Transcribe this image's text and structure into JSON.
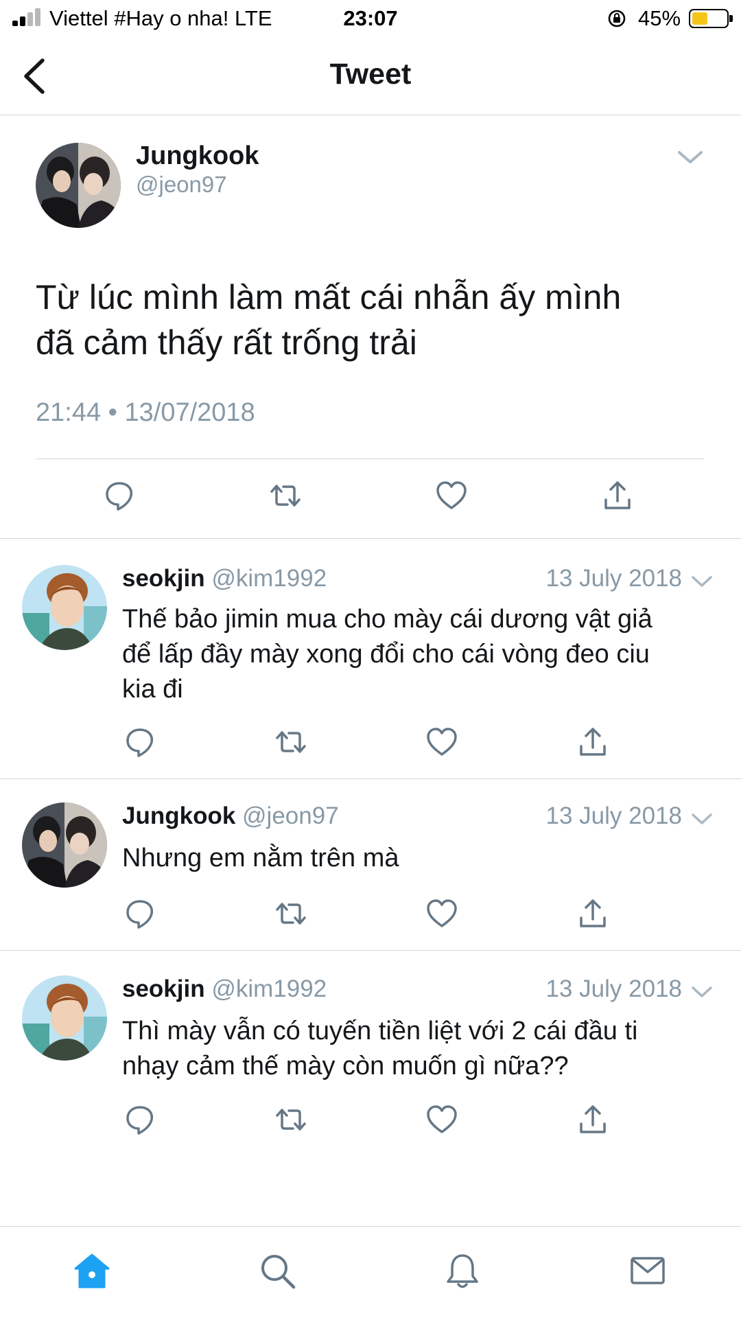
{
  "status_bar": {
    "carrier": "Viettel #Hay o nha!  LTE",
    "time": "23:07",
    "battery": "45%",
    "battery_level": 0.45
  },
  "nav": {
    "title": "Tweet"
  },
  "main_tweet": {
    "name": "Jungkook",
    "handle": "@jeon97",
    "text_line1": "Từ lúc mình làm mất cái nhẫn ấy mình",
    "text_line2": "đã cảm thấy rất trống trải",
    "timestamp": "21:44 • 13/07/2018"
  },
  "replies": [
    {
      "name": "seokjin",
      "handle": "@kim1992",
      "date": "13 July 2018",
      "text_line1": "Thế bảo jimin mua cho mày cái dương vật giả",
      "text_line2": "để lấp đầy mày xong đổi cho cái vòng đeo ciu",
      "text_line3": "kia đi"
    },
    {
      "name": "Jungkook",
      "handle": "@jeon97",
      "date": "13 July 2018",
      "text_line1": "Nhưng em nằm trên mà"
    },
    {
      "name": "seokjin",
      "handle": "@kim1992",
      "date": "13 July 2018",
      "text_line1": "Thì mày vẫn có tuyến tiền liệt với 2 cái đầu ti",
      "text_line2": "nhạy cảm thế mày còn muốn gì nữa??"
    }
  ],
  "icons": {
    "reply": "reply-icon",
    "retweet": "retweet-icon",
    "like": "heart-icon",
    "share": "share-icon",
    "home": "home-icon",
    "search": "search-icon",
    "notifications": "bell-icon",
    "messages": "mail-icon"
  },
  "colors": {
    "accent": "#1da1f2",
    "secondary_text": "#8899a6",
    "icon_gray": "#657786",
    "divider": "#d0d5da"
  }
}
